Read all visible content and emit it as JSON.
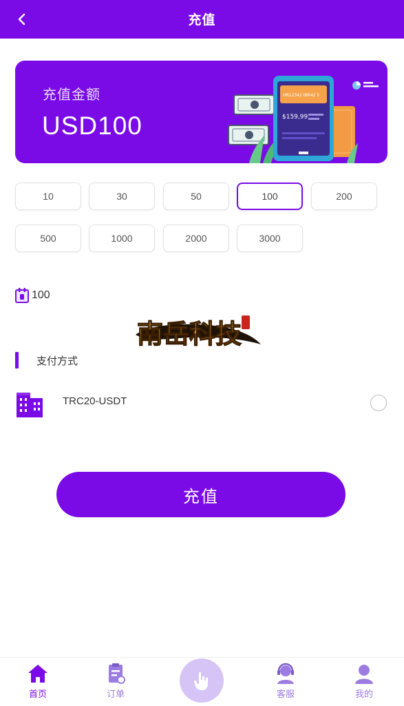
{
  "header": {
    "title": "充值",
    "back_icon": "chevron-left-icon"
  },
  "banner": {
    "label": "充值金额",
    "amount": "USD100",
    "illustration": "wallet-payment-illustration",
    "card_text_1": "HR12342 IBR42 5",
    "card_price": "$159,99"
  },
  "amounts": {
    "options": [
      "10",
      "30",
      "50",
      "100",
      "200",
      "500",
      "1000",
      "2000",
      "3000"
    ],
    "selected": "100"
  },
  "input": {
    "icon": "calendar-icon",
    "value": "100"
  },
  "watermark": {
    "text": "南岳科技"
  },
  "payment": {
    "section_title": "支付方式",
    "method_label": "TRC20-USDT",
    "method_icon": "building-icon"
  },
  "submit": {
    "label": "充值"
  },
  "nav": {
    "items": [
      {
        "label": "首页",
        "icon": "home-icon"
      },
      {
        "label": "订单",
        "icon": "order-icon"
      },
      {
        "label": "",
        "icon": "tap-hand-icon"
      },
      {
        "label": "客服",
        "icon": "support-icon"
      },
      {
        "label": "我的",
        "icon": "user-icon"
      }
    ]
  },
  "colors": {
    "accent": "#7a0be6",
    "nav_label": "#9c7ce0",
    "center_button": "#d7c4f6"
  }
}
